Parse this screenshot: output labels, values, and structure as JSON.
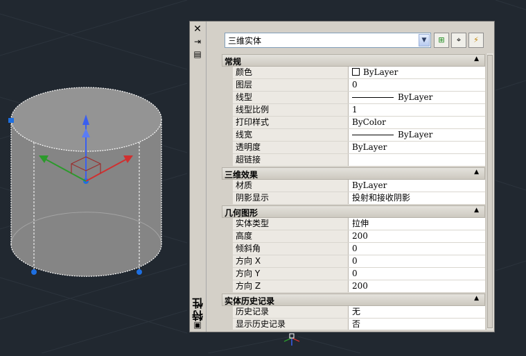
{
  "palette": {
    "title": "特性",
    "icons": [
      "close-icon",
      "pin-icon",
      "options-icon",
      "palette-settings-icon"
    ],
    "selector_value": "三维实体",
    "tool_buttons": [
      "toggle-pickadd-icon",
      "select-objects-icon",
      "quick-select-icon"
    ],
    "sections": [
      {
        "title": "常规",
        "rows": [
          {
            "name": "颜色",
            "value": "ByLayer",
            "kind": "color"
          },
          {
            "name": "图层",
            "value": "0"
          },
          {
            "name": "线型",
            "value": "ByLayer",
            "kind": "line"
          },
          {
            "name": "线型比例",
            "value": "1"
          },
          {
            "name": "打印样式",
            "value": "ByColor"
          },
          {
            "name": "线宽",
            "value": "ByLayer",
            "kind": "line"
          },
          {
            "name": "透明度",
            "value": "ByLayer"
          },
          {
            "name": "超链接",
            "value": ""
          }
        ]
      },
      {
        "title": "三维效果",
        "rows": [
          {
            "name": "材质",
            "value": "ByLayer"
          },
          {
            "name": "阴影显示",
            "value": "投射和接收阴影"
          }
        ]
      },
      {
        "title": "几何图形",
        "rows": [
          {
            "name": "实体类型",
            "value": "拉伸"
          },
          {
            "name": "高度",
            "value": "200"
          },
          {
            "name": "倾斜角",
            "value": "0"
          },
          {
            "name": "方向 X",
            "value": "0"
          },
          {
            "name": "方向 Y",
            "value": "0"
          },
          {
            "name": "方向 Z",
            "value": "200"
          }
        ]
      },
      {
        "title": "实体历史记录",
        "rows": [
          {
            "name": "历史记录",
            "value": "无"
          },
          {
            "name": "显示历史记录",
            "value": "否"
          }
        ]
      }
    ]
  },
  "colors": {
    "background": "#212830",
    "grid_line": "#2c343d",
    "solid_fill": "#8b8b8b",
    "grip": "#1e6fe0",
    "gizmo_z": "#3a5ff0",
    "gizmo_x": "#d03030",
    "gizmo_y": "#2c9a2c"
  }
}
